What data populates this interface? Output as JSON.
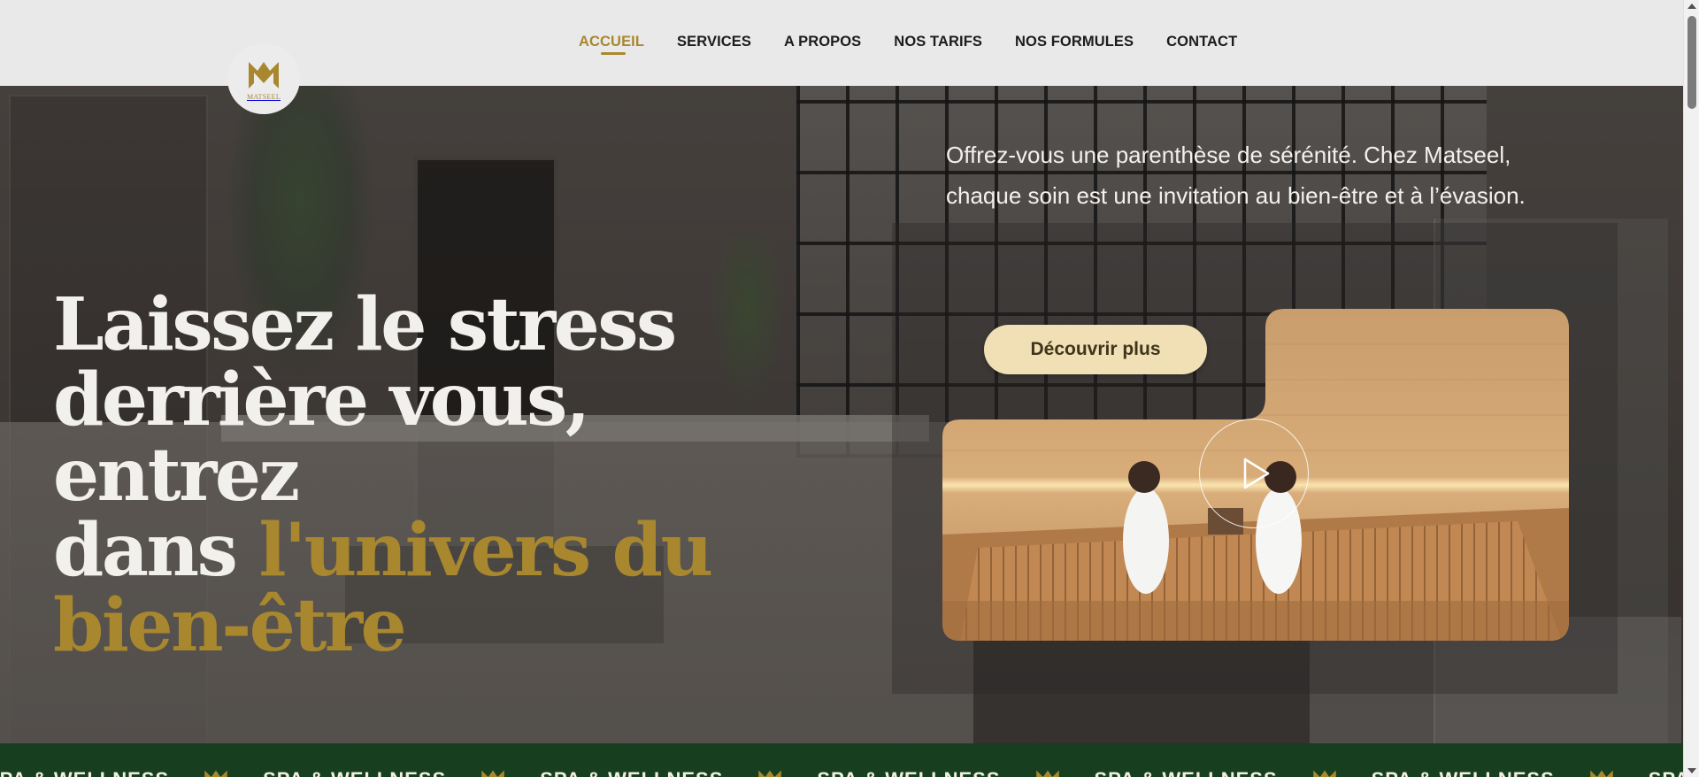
{
  "brand": {
    "logo_text": "MATSEEL"
  },
  "nav": {
    "items": [
      {
        "label": "ACCUEIL",
        "active": true
      },
      {
        "label": "SERVICES"
      },
      {
        "label": "A PROPOS"
      },
      {
        "label": "NOS TARIFS"
      },
      {
        "label": "NOS FORMULES"
      },
      {
        "label": "CONTACT"
      }
    ]
  },
  "hero": {
    "headline_line1": "Laissez le stress",
    "headline_line2": "derrière vous, entrez",
    "headline_line3_plain": "dans ",
    "headline_line3_gold": "l'univers du",
    "headline_line4_gold": "bien-être",
    "intro": "Offrez-vous une parenthèse de sérénité. Chez Matseel, chaque soin est une invitation au bien-être et à l’évasion.",
    "cta_label": "Découvrir plus",
    "video_icon": "play-icon"
  },
  "band": {
    "text": "SPA & WELLNESS",
    "icon": "matseel-logo-icon",
    "repeat": 7
  },
  "colors": {
    "gold": "#a8872f",
    "cta_bg": "#f1e0b6",
    "band_bg": "#173e1e",
    "header_bg": "#e9e9e9"
  }
}
